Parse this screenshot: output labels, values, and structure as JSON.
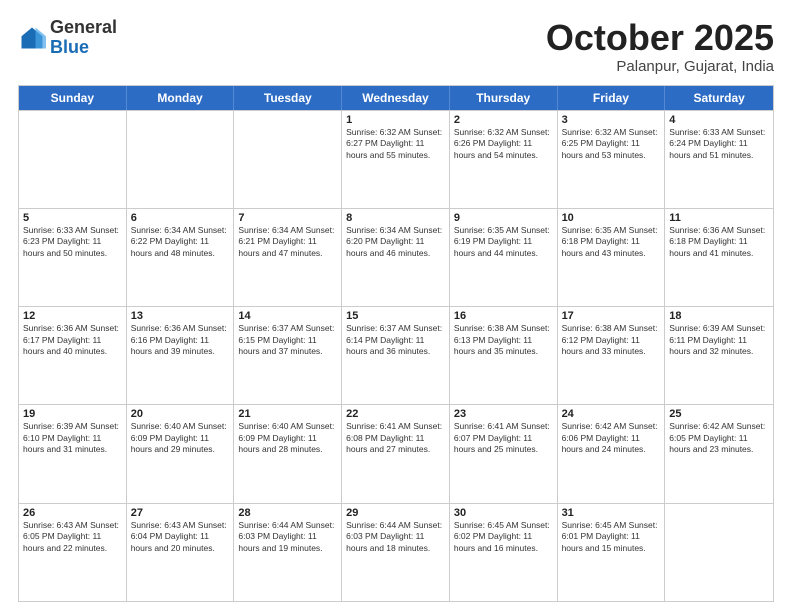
{
  "header": {
    "logo_general": "General",
    "logo_blue": "Blue",
    "month_title": "October 2025",
    "subtitle": "Palanpur, Gujarat, India"
  },
  "days_of_week": [
    "Sunday",
    "Monday",
    "Tuesday",
    "Wednesday",
    "Thursday",
    "Friday",
    "Saturday"
  ],
  "weeks": [
    [
      {
        "day": "",
        "text": ""
      },
      {
        "day": "",
        "text": ""
      },
      {
        "day": "",
        "text": ""
      },
      {
        "day": "1",
        "text": "Sunrise: 6:32 AM\nSunset: 6:27 PM\nDaylight: 11 hours\nand 55 minutes."
      },
      {
        "day": "2",
        "text": "Sunrise: 6:32 AM\nSunset: 6:26 PM\nDaylight: 11 hours\nand 54 minutes."
      },
      {
        "day": "3",
        "text": "Sunrise: 6:32 AM\nSunset: 6:25 PM\nDaylight: 11 hours\nand 53 minutes."
      },
      {
        "day": "4",
        "text": "Sunrise: 6:33 AM\nSunset: 6:24 PM\nDaylight: 11 hours\nand 51 minutes."
      }
    ],
    [
      {
        "day": "5",
        "text": "Sunrise: 6:33 AM\nSunset: 6:23 PM\nDaylight: 11 hours\nand 50 minutes."
      },
      {
        "day": "6",
        "text": "Sunrise: 6:34 AM\nSunset: 6:22 PM\nDaylight: 11 hours\nand 48 minutes."
      },
      {
        "day": "7",
        "text": "Sunrise: 6:34 AM\nSunset: 6:21 PM\nDaylight: 11 hours\nand 47 minutes."
      },
      {
        "day": "8",
        "text": "Sunrise: 6:34 AM\nSunset: 6:20 PM\nDaylight: 11 hours\nand 46 minutes."
      },
      {
        "day": "9",
        "text": "Sunrise: 6:35 AM\nSunset: 6:19 PM\nDaylight: 11 hours\nand 44 minutes."
      },
      {
        "day": "10",
        "text": "Sunrise: 6:35 AM\nSunset: 6:18 PM\nDaylight: 11 hours\nand 43 minutes."
      },
      {
        "day": "11",
        "text": "Sunrise: 6:36 AM\nSunset: 6:18 PM\nDaylight: 11 hours\nand 41 minutes."
      }
    ],
    [
      {
        "day": "12",
        "text": "Sunrise: 6:36 AM\nSunset: 6:17 PM\nDaylight: 11 hours\nand 40 minutes."
      },
      {
        "day": "13",
        "text": "Sunrise: 6:36 AM\nSunset: 6:16 PM\nDaylight: 11 hours\nand 39 minutes."
      },
      {
        "day": "14",
        "text": "Sunrise: 6:37 AM\nSunset: 6:15 PM\nDaylight: 11 hours\nand 37 minutes."
      },
      {
        "day": "15",
        "text": "Sunrise: 6:37 AM\nSunset: 6:14 PM\nDaylight: 11 hours\nand 36 minutes."
      },
      {
        "day": "16",
        "text": "Sunrise: 6:38 AM\nSunset: 6:13 PM\nDaylight: 11 hours\nand 35 minutes."
      },
      {
        "day": "17",
        "text": "Sunrise: 6:38 AM\nSunset: 6:12 PM\nDaylight: 11 hours\nand 33 minutes."
      },
      {
        "day": "18",
        "text": "Sunrise: 6:39 AM\nSunset: 6:11 PM\nDaylight: 11 hours\nand 32 minutes."
      }
    ],
    [
      {
        "day": "19",
        "text": "Sunrise: 6:39 AM\nSunset: 6:10 PM\nDaylight: 11 hours\nand 31 minutes."
      },
      {
        "day": "20",
        "text": "Sunrise: 6:40 AM\nSunset: 6:09 PM\nDaylight: 11 hours\nand 29 minutes."
      },
      {
        "day": "21",
        "text": "Sunrise: 6:40 AM\nSunset: 6:09 PM\nDaylight: 11 hours\nand 28 minutes."
      },
      {
        "day": "22",
        "text": "Sunrise: 6:41 AM\nSunset: 6:08 PM\nDaylight: 11 hours\nand 27 minutes."
      },
      {
        "day": "23",
        "text": "Sunrise: 6:41 AM\nSunset: 6:07 PM\nDaylight: 11 hours\nand 25 minutes."
      },
      {
        "day": "24",
        "text": "Sunrise: 6:42 AM\nSunset: 6:06 PM\nDaylight: 11 hours\nand 24 minutes."
      },
      {
        "day": "25",
        "text": "Sunrise: 6:42 AM\nSunset: 6:05 PM\nDaylight: 11 hours\nand 23 minutes."
      }
    ],
    [
      {
        "day": "26",
        "text": "Sunrise: 6:43 AM\nSunset: 6:05 PM\nDaylight: 11 hours\nand 22 minutes."
      },
      {
        "day": "27",
        "text": "Sunrise: 6:43 AM\nSunset: 6:04 PM\nDaylight: 11 hours\nand 20 minutes."
      },
      {
        "day": "28",
        "text": "Sunrise: 6:44 AM\nSunset: 6:03 PM\nDaylight: 11 hours\nand 19 minutes."
      },
      {
        "day": "29",
        "text": "Sunrise: 6:44 AM\nSunset: 6:03 PM\nDaylight: 11 hours\nand 18 minutes."
      },
      {
        "day": "30",
        "text": "Sunrise: 6:45 AM\nSunset: 6:02 PM\nDaylight: 11 hours\nand 16 minutes."
      },
      {
        "day": "31",
        "text": "Sunrise: 6:45 AM\nSunset: 6:01 PM\nDaylight: 11 hours\nand 15 minutes."
      },
      {
        "day": "",
        "text": ""
      }
    ]
  ]
}
